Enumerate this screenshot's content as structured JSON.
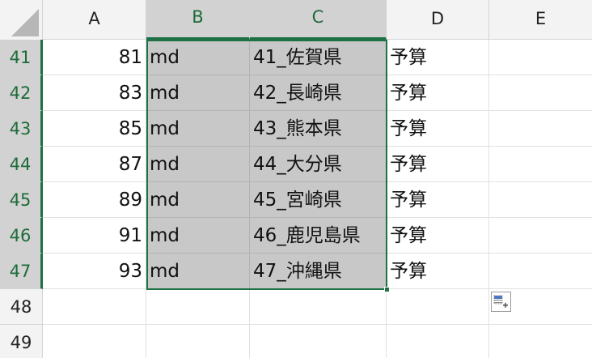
{
  "columns": [
    {
      "label": "A"
    },
    {
      "label": "B"
    },
    {
      "label": "C"
    },
    {
      "label": "D"
    },
    {
      "label": "E"
    }
  ],
  "rows": [
    {
      "number": "41",
      "a": "81",
      "b": "md",
      "c": "41_佐賀県",
      "d": "予算"
    },
    {
      "number": "42",
      "a": "83",
      "b": "md",
      "c": "42_長崎県",
      "d": "予算"
    },
    {
      "number": "43",
      "a": "85",
      "b": "md",
      "c": "43_熊本県",
      "d": "予算"
    },
    {
      "number": "44",
      "a": "87",
      "b": "md",
      "c": "44_大分県",
      "d": "予算"
    },
    {
      "number": "45",
      "a": "89",
      "b": "md",
      "c": "45_宮崎県",
      "d": "予算"
    },
    {
      "number": "46",
      "a": "91",
      "b": "md",
      "c": "46_鹿児島県",
      "d": "予算"
    },
    {
      "number": "47",
      "a": "93",
      "b": "md",
      "c": "47_沖縄県",
      "d": "予算"
    },
    {
      "number": "48",
      "a": "",
      "b": "",
      "c": "",
      "d": ""
    },
    {
      "number": "49",
      "a": "",
      "b": "",
      "c": "",
      "d": ""
    }
  ],
  "colors": {
    "selection_accent": "#1e7145",
    "selection_fill": "#c8c8c8",
    "header_fill": "#f3f3f3"
  },
  "icons": {
    "quick_analysis": "quick-analysis-icon",
    "select_all": "select-all-triangle-icon"
  }
}
